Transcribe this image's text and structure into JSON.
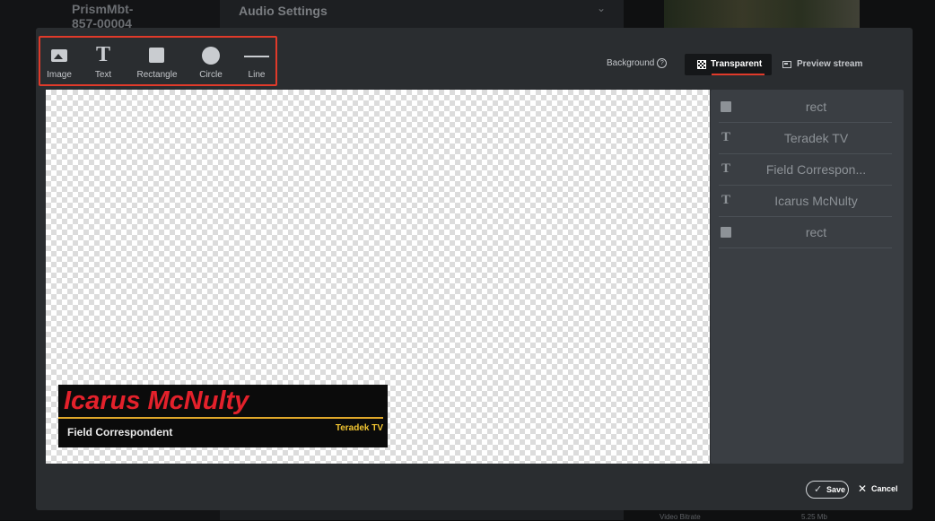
{
  "background_app": {
    "device_name": "PrismMbt-\n857-00004",
    "section_title": "Audio Settings",
    "bottom_left_text": "Video Bitrate",
    "bottom_right_text": "5.25 Mb"
  },
  "toolbar": {
    "tools": [
      {
        "label": "Image",
        "icon": "image-icon"
      },
      {
        "label": "Text",
        "icon": "text-icon"
      },
      {
        "label": "Rectangle",
        "icon": "rectangle-icon"
      },
      {
        "label": "Circle",
        "icon": "circle-icon"
      },
      {
        "label": "Line",
        "icon": "line-icon"
      }
    ],
    "text_glyph": "T",
    "background_label": "Background",
    "help_glyph": "?",
    "transparent_label": "Transparent",
    "preview_label": "Preview stream"
  },
  "canvas": {
    "lower_third": {
      "name": "Icarus McNulty",
      "title": "Field Correspondent",
      "brand": "Teradek TV",
      "colors": {
        "name": "#e3212b",
        "bar": "#e0a82a",
        "brand": "#f2c531",
        "background": "#0b0b0b"
      }
    }
  },
  "layers": [
    {
      "type": "rect",
      "label": "rect"
    },
    {
      "type": "text",
      "label": "Teradek TV"
    },
    {
      "type": "text",
      "label": "Field Correspon..."
    },
    {
      "type": "text",
      "label": "Icarus McNulty"
    },
    {
      "type": "rect",
      "label": "rect"
    }
  ],
  "footer": {
    "save_label": "Save",
    "cancel_label": "Cancel",
    "check_glyph": "✓",
    "cancel_glyph": "✕"
  },
  "colors": {
    "accent": "#e03a2a",
    "modal_bg": "#2a2d30",
    "layers_bg": "#3a3e43"
  }
}
